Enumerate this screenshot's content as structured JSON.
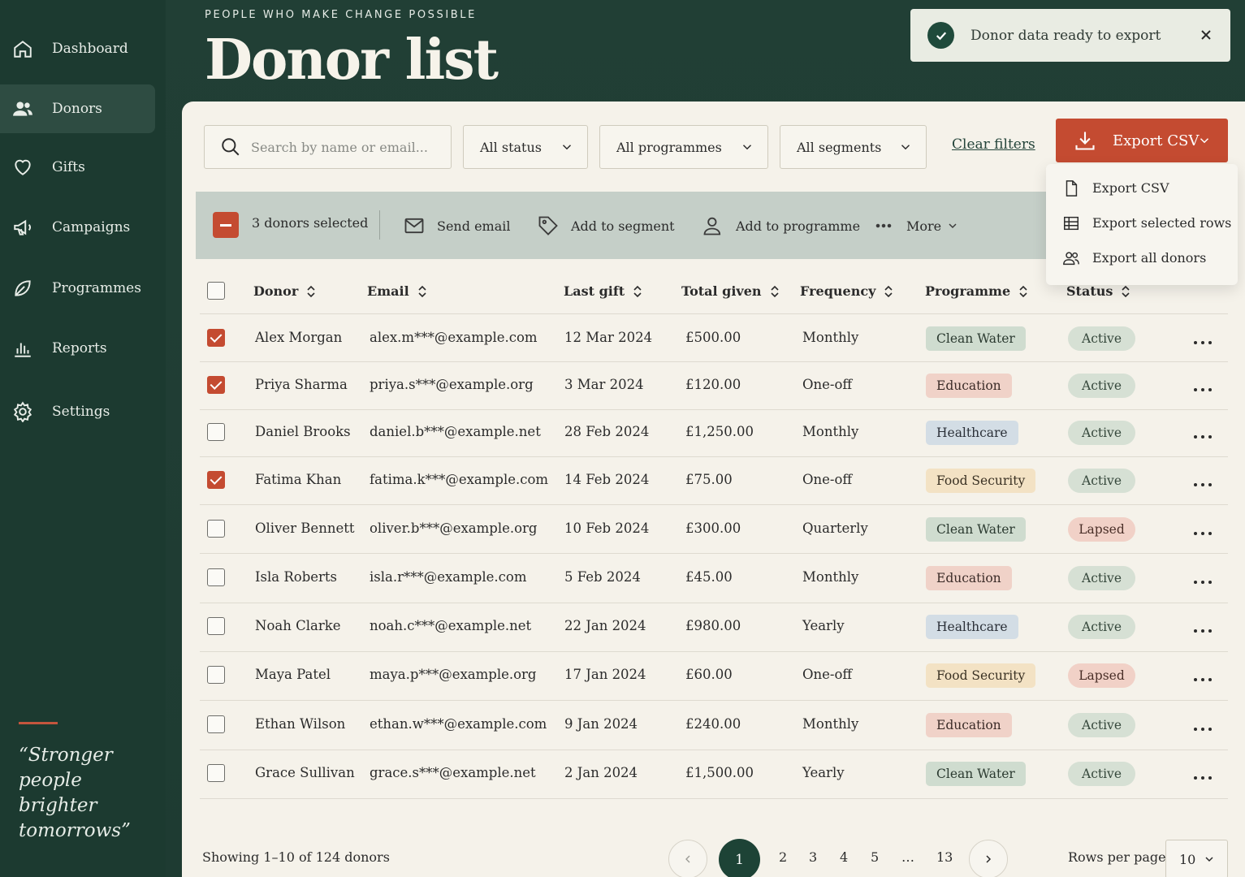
{
  "sidebar": {
    "items": [
      {
        "label": "Dashboard",
        "icon": "home-icon"
      },
      {
        "label": "Donors",
        "icon": "users-icon",
        "active": true
      },
      {
        "label": "Gifts",
        "icon": "heart-icon"
      },
      {
        "label": "Campaigns",
        "icon": "megaphone-icon"
      },
      {
        "label": "Programmes",
        "icon": "leaf-icon"
      },
      {
        "label": "Reports",
        "icon": "bar-chart-icon"
      },
      {
        "label": "Settings",
        "icon": "gear-icon"
      }
    ],
    "quote": "“Stronger people brighter tomorrows”"
  },
  "header": {
    "eyebrow": "PEOPLE WHO MAKE CHANGE POSSIBLE",
    "title": "Donor list"
  },
  "toast": {
    "message": "Donor data ready to export"
  },
  "filters": {
    "search_placeholder": "Search by name or email...",
    "status": "All status",
    "programmes": "All programmes",
    "segments": "All segments",
    "clear": "Clear filters"
  },
  "export": {
    "button_label": "Export CSV",
    "menu": [
      "Export CSV",
      "Export selected rows",
      "Export all donors"
    ]
  },
  "bulk": {
    "selected_label": "3 donors selected",
    "send_email": "Send email",
    "add_segment": "Add to segment",
    "add_programme": "Add to programme",
    "more": "More"
  },
  "table": {
    "columns": [
      "Donor",
      "Email",
      "Last gift",
      "Total given",
      "Frequency",
      "Programme",
      "Status"
    ],
    "rows": [
      {
        "name": "Alex Morgan",
        "email": "alex.m***@example.com",
        "last_gift": "12 Mar 2024",
        "total": "£500.00",
        "frequency": "Monthly",
        "programme": "Clean Water",
        "status": "Active",
        "checked": true
      },
      {
        "name": "Priya Sharma",
        "email": "priya.s***@example.org",
        "last_gift": "3 Mar 2024",
        "total": "£120.00",
        "frequency": "One-off",
        "programme": "Education",
        "status": "Active",
        "checked": true
      },
      {
        "name": "Daniel Brooks",
        "email": "daniel.b***@example.net",
        "last_gift": "28 Feb 2024",
        "total": "£1,250.00",
        "frequency": "Monthly",
        "programme": "Healthcare",
        "status": "Active",
        "checked": false
      },
      {
        "name": "Fatima Khan",
        "email": "fatima.k***@example.com",
        "last_gift": "14 Feb 2024",
        "total": "£75.00",
        "frequency": "One-off",
        "programme": "Food Security",
        "status": "Active",
        "checked": true
      },
      {
        "name": "Oliver Bennett",
        "email": "oliver.b***@example.org",
        "last_gift": "10 Feb 2024",
        "total": "£300.00",
        "frequency": "Quarterly",
        "programme": "Clean Water",
        "status": "Lapsed",
        "checked": false
      },
      {
        "name": "Isla Roberts",
        "email": "isla.r***@example.com",
        "last_gift": "5 Feb 2024",
        "total": "£45.00",
        "frequency": "Monthly",
        "programme": "Education",
        "status": "Active",
        "checked": false
      },
      {
        "name": "Noah Clarke",
        "email": "noah.c***@example.net",
        "last_gift": "22 Jan 2024",
        "total": "£980.00",
        "frequency": "Yearly",
        "programme": "Healthcare",
        "status": "Active",
        "checked": false
      },
      {
        "name": "Maya Patel",
        "email": "maya.p***@example.org",
        "last_gift": "17 Jan 2024",
        "total": "£60.00",
        "frequency": "One-off",
        "programme": "Food Security",
        "status": "Lapsed",
        "checked": false
      },
      {
        "name": "Ethan Wilson",
        "email": "ethan.w***@example.com",
        "last_gift": "9 Jan 2024",
        "total": "£240.00",
        "frequency": "Monthly",
        "programme": "Education",
        "status": "Active",
        "checked": false
      },
      {
        "name": "Grace Sullivan",
        "email": "grace.s***@example.net",
        "last_gift": "2 Jan 2024",
        "total": "£1,500.00",
        "frequency": "Yearly",
        "programme": "Clean Water",
        "status": "Active",
        "checked": false
      }
    ]
  },
  "footer": {
    "showing": "Showing 1–10 of 124 donors",
    "pages": [
      "1",
      "2",
      "3",
      "4",
      "5",
      "…",
      "13"
    ],
    "current_page": "1",
    "rows_per_page_label": "Rows per page",
    "rows_per_page": "10"
  },
  "colors": {
    "sidebar_bg": "#1c3a30",
    "accent": "#c44b31",
    "card_bg": "#f5f2ea",
    "bulk_bar": "#c5cfc8"
  }
}
